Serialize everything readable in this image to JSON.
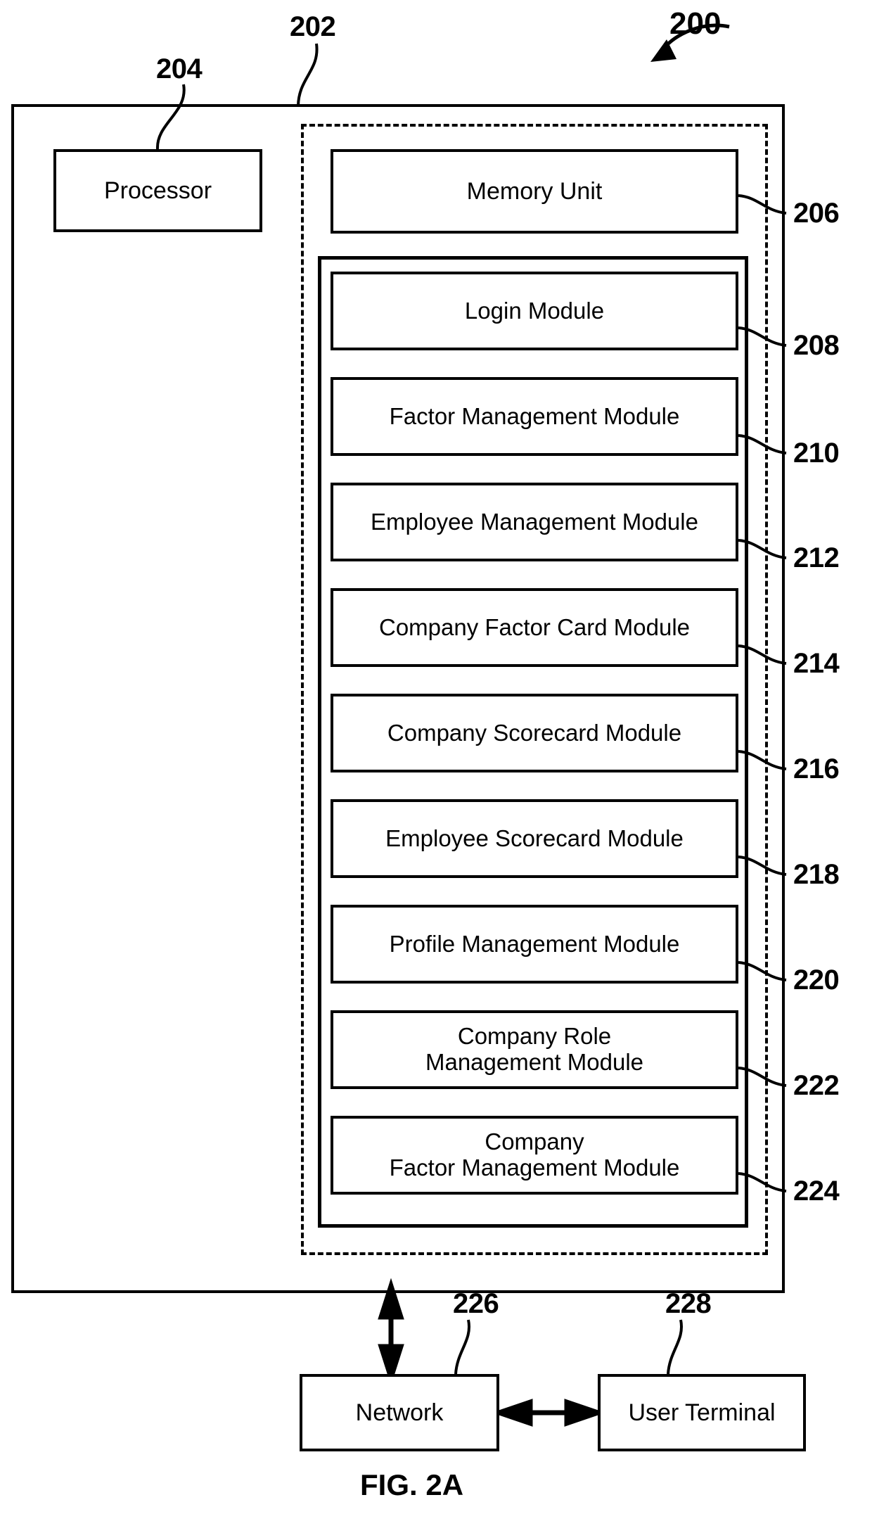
{
  "figure": {
    "caption": "FIG. 2A",
    "system_ref": "200"
  },
  "refs": {
    "system": "200",
    "server": "202",
    "processor": "204",
    "memory_unit": "206",
    "login_module": "208",
    "factor_management_module": "210",
    "employee_management_module": "212",
    "company_factor_card_module": "214",
    "company_scorecard_module": "216",
    "employee_scorecard_module": "218",
    "profile_management_module": "220",
    "company_role_management_module": "222",
    "company_factor_management_module": "224",
    "network": "226",
    "user_terminal": "228"
  },
  "blocks": {
    "processor": "Processor",
    "memory_unit": "Memory Unit",
    "network": "Network",
    "user_terminal": "User Terminal"
  },
  "modules": [
    {
      "label": "Login Module",
      "ref": "208"
    },
    {
      "label": "Factor Management Module",
      "ref": "210"
    },
    {
      "label": "Employee Management Module",
      "ref": "212"
    },
    {
      "label": "Company Factor Card Module",
      "ref": "214"
    },
    {
      "label": "Company Scorecard Module",
      "ref": "216"
    },
    {
      "label": "Employee Scorecard Module",
      "ref": "218"
    },
    {
      "label": "Profile Management Module",
      "ref": "220"
    },
    {
      "label": "Company Role\nManagement Module",
      "ref": "222"
    },
    {
      "label": "Company\nFactor Management Module",
      "ref": "224"
    }
  ],
  "colors": {
    "ink": "#000000",
    "paper": "#ffffff"
  }
}
